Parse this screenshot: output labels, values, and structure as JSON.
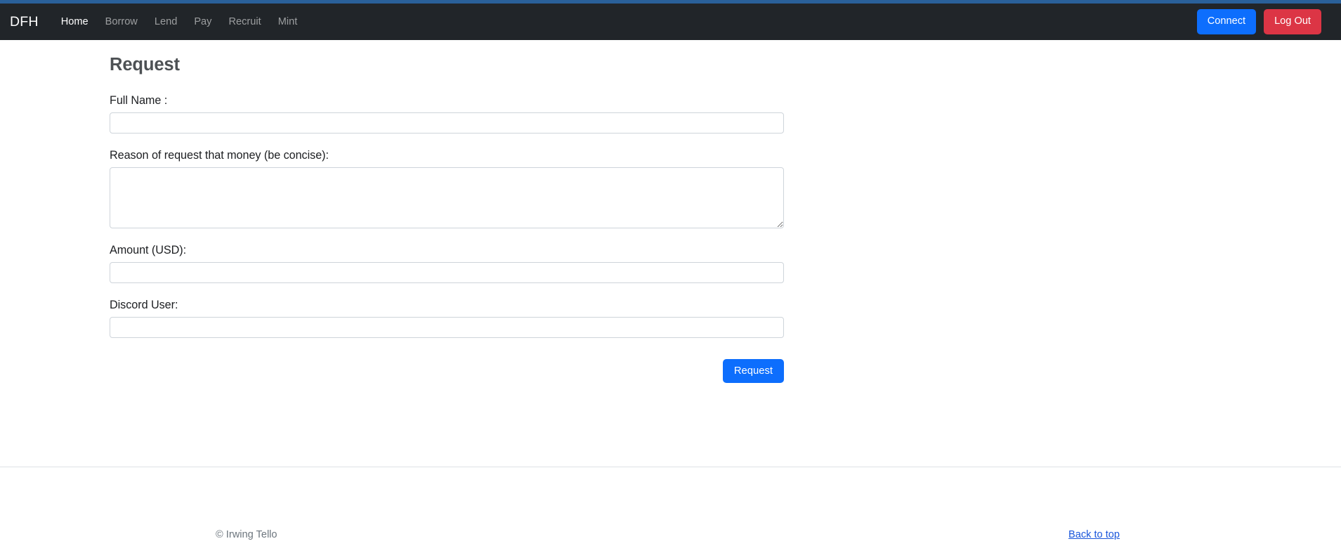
{
  "accent": {
    "top_bar_color": "#2a6099",
    "primary_color": "#0d6efd",
    "danger_color": "#dc3545",
    "navbar_color": "#212529",
    "link_color": "#1a56db"
  },
  "navbar": {
    "brand": "DFH",
    "links": [
      {
        "label": "Home",
        "active": true
      },
      {
        "label": "Borrow",
        "active": false
      },
      {
        "label": "Lend",
        "active": false
      },
      {
        "label": "Pay",
        "active": false
      },
      {
        "label": "Recruit",
        "active": false
      },
      {
        "label": "Mint",
        "active": false
      }
    ],
    "connect_label": "Connect",
    "logout_label": "Log Out"
  },
  "main": {
    "title": "Request",
    "fields": [
      {
        "label": "Full Name :",
        "value": "",
        "placeholder": "",
        "type": "text"
      },
      {
        "label": "Reason of request that money (be concise):",
        "value": "",
        "placeholder": "",
        "type": "textarea"
      },
      {
        "label": "Amount (USD):",
        "value": "",
        "placeholder": "",
        "type": "text"
      },
      {
        "label": "Discord User:",
        "value": "",
        "placeholder": "",
        "type": "text"
      }
    ],
    "submit_label": "Request"
  },
  "footer": {
    "copyright": "© Irwing Tello",
    "back_to_top": "Back to top"
  }
}
